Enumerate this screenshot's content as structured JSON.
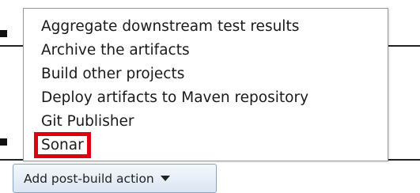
{
  "menu": {
    "items": [
      {
        "label": "Aggregate downstream test results"
      },
      {
        "label": "Archive the artifacts"
      },
      {
        "label": "Build other projects"
      },
      {
        "label": "Deploy artifacts to Maven repository"
      },
      {
        "label": "Git Publisher"
      },
      {
        "label": "Sonar"
      }
    ],
    "highlight_color": "#e0000f"
  },
  "button": {
    "label": "Add post-build action",
    "icon": "dropdown-arrow-icon"
  }
}
